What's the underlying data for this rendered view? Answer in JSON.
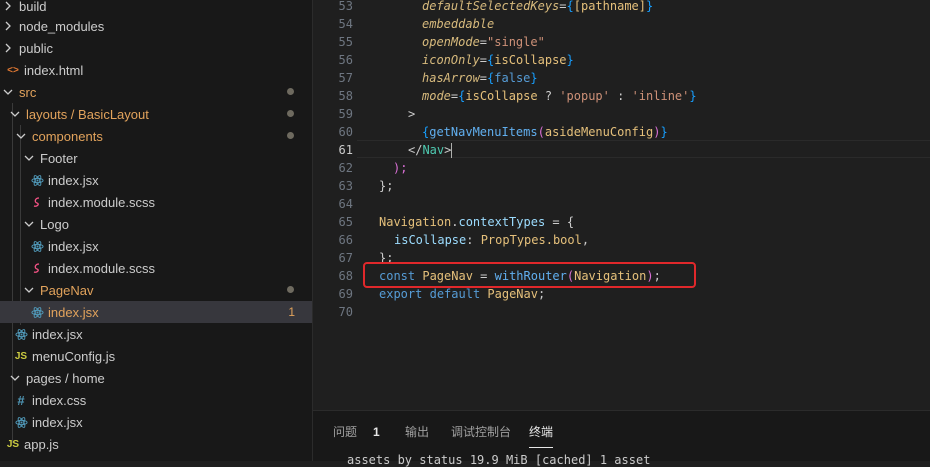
{
  "sidebar": {
    "items": [
      {
        "label": "build",
        "type": "folder",
        "open": false
      },
      {
        "label": "node_modules",
        "type": "folder",
        "open": false
      },
      {
        "label": "public",
        "type": "folder",
        "open": true
      },
      {
        "label": "index.html",
        "type": "html"
      },
      {
        "label": "src",
        "type": "folder",
        "open": true,
        "color": "orange"
      },
      {
        "label": "layouts / BasicLayout",
        "type": "folder",
        "open": true,
        "color": "orange"
      },
      {
        "label": "components",
        "type": "folder",
        "open": true,
        "color": "orange"
      },
      {
        "label": "Footer",
        "type": "folder",
        "open": true
      },
      {
        "label": "index.jsx",
        "type": "react"
      },
      {
        "label": "index.module.scss",
        "type": "scss"
      },
      {
        "label": "Logo",
        "type": "folder",
        "open": true
      },
      {
        "label": "index.jsx",
        "type": "react"
      },
      {
        "label": "index.module.scss",
        "type": "scss"
      },
      {
        "label": "PageNav",
        "type": "folder",
        "open": true,
        "color": "orange"
      },
      {
        "label": "index.jsx",
        "type": "react",
        "color": "orange",
        "selected": true,
        "problems": "1"
      },
      {
        "label": "index.jsx",
        "type": "react"
      },
      {
        "label": "menuConfig.js",
        "type": "js"
      },
      {
        "label": "pages / home",
        "type": "folder",
        "open": true
      },
      {
        "label": "index.css",
        "type": "css"
      },
      {
        "label": "index.jsx",
        "type": "react"
      },
      {
        "label": "app.js",
        "type": "js"
      }
    ],
    "icons": {
      "react": "react-icon",
      "scss": "sass-icon",
      "html": "html-icon",
      "js": "js-icon",
      "css": "hash-icon"
    }
  },
  "editor": {
    "line_numbers": [
      "53",
      "54",
      "55",
      "56",
      "57",
      "58",
      "59",
      "60",
      "61",
      "62",
      "63",
      "64",
      "65",
      "66",
      "67",
      "68",
      "69",
      "70"
    ],
    "active_line": "61",
    "code": {
      "l53_attr": "defaultSelectedKeys",
      "l53_val": "[pathname]",
      "l54_attr": "embeddable",
      "l55_attr": "openMode",
      "l55_val": "\"single\"",
      "l56_attr": "iconOnly",
      "l56_val": "isCollapse",
      "l57_attr": "hasArrow",
      "l57_val": "false",
      "l58_attr": "mode",
      "l58_cond": "isCollapse",
      "l58_a": "'popup'",
      "l58_b": "'inline'",
      "l59": ">",
      "l60_fn": "getNavMenuItems",
      "l60_arg": "asideMenuConfig",
      "l61_tag": "Nav",
      "l62": ");",
      "l63": "};",
      "l65_obj": "Navigation",
      "l65_prop": "contextTypes",
      "l66_key": "isCollapse",
      "l66_val": "PropTypes.bool",
      "l67": "};",
      "l68_kw": "const",
      "l68_name": "PageNav",
      "l68_fn": "withRouter",
      "l68_arg": "Navigation",
      "l69_kw1": "export",
      "l69_kw2": "default",
      "l69_name": "PageNav"
    }
  },
  "panel": {
    "tabs": [
      {
        "label": "问题",
        "count": "1"
      },
      {
        "label": "输出"
      },
      {
        "label": "调试控制台"
      },
      {
        "label": "终端",
        "active": true
      }
    ],
    "terminal_text": "assets by status 19.9 MiB [cached] 1 asset"
  },
  "colors": {
    "accent_warning": "#e2a35c",
    "highlight_box": "#e0282b"
  }
}
